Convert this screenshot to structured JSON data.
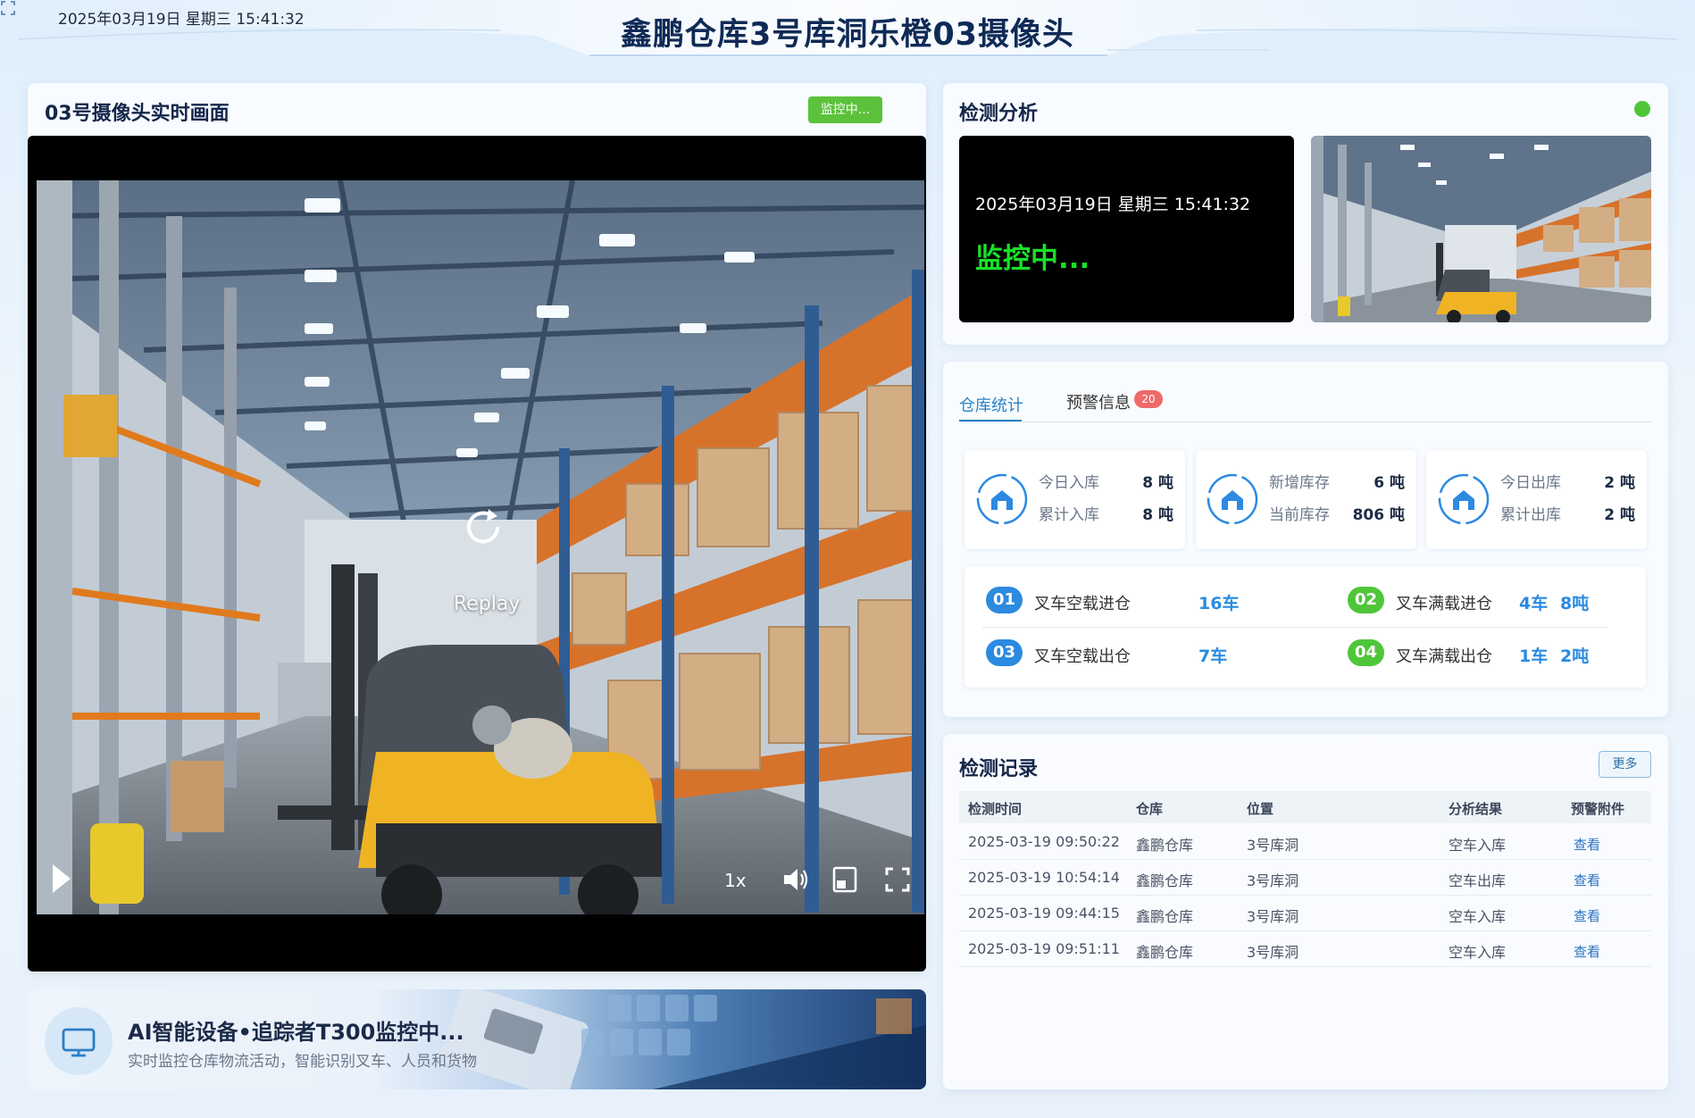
{
  "header": {
    "datetime": "2025年03月19日 星期三 15:41:32",
    "title": "鑫鹏仓库3号库洞乐橙03摄像头",
    "fullscreen_icon": "fullscreen-icon"
  },
  "video_panel": {
    "title": "03号摄像头实时画面",
    "status_badge": "监控中...",
    "replay_label": "Replay",
    "speed": "1x",
    "icons": [
      "play-icon",
      "replay-icon",
      "volume-icon",
      "picture-in-picture-icon",
      "fullscreen-icon"
    ]
  },
  "banner": {
    "title": "AI智能设备•追踪者T300监控中...",
    "subtitle": "实时监控仓库物流活动，智能识别叉车、人员和货物",
    "icon": "monitor-icon"
  },
  "detection": {
    "title": "检测分析",
    "datetime": "2025年03月19日 星期三 15:41:32",
    "status": "监控中...",
    "status_color": "#19e227"
  },
  "stats": {
    "tabs": [
      {
        "label": "仓库统计",
        "active": true
      },
      {
        "label": "预警信息",
        "active": false,
        "count": "20"
      }
    ],
    "cards": [
      {
        "icon": "warehouse-in-icon",
        "row1_label": "今日入库",
        "row1_value": "8 吨",
        "row2_label": "累计入库",
        "row2_value": "8 吨"
      },
      {
        "icon": "warehouse-icon",
        "row1_label": "新增库存",
        "row1_value": "6 吨",
        "row2_label": "当前库存",
        "row2_value": "806 吨"
      },
      {
        "icon": "warehouse-out-icon",
        "row1_label": "今日出库",
        "row1_value": "2 吨",
        "row2_label": "累计出库",
        "row2_value": "2 吨"
      }
    ],
    "forklift": [
      {
        "num": "01",
        "label": "叉车空载进仓",
        "value1": "16车",
        "value2": ""
      },
      {
        "num": "02",
        "label": "叉车满载进仓",
        "value1": "4车",
        "value2": "8吨"
      },
      {
        "num": "03",
        "label": "叉车空载出仓",
        "value1": "7车",
        "value2": ""
      },
      {
        "num": "04",
        "label": "叉车满载出仓",
        "value1": "1车",
        "value2": "2吨"
      }
    ]
  },
  "records": {
    "title": "检测记录",
    "more": "更多",
    "columns": [
      "检测时间",
      "仓库",
      "位置",
      "分析结果",
      "预警附件"
    ],
    "rows": [
      {
        "time": "2025-03-19 09:50:22",
        "warehouse": "鑫鹏仓库",
        "location": "3号库洞",
        "result": "空车入库",
        "attachment": "查看"
      },
      {
        "time": "2025-03-19 10:54:14",
        "warehouse": "鑫鹏仓库",
        "location": "3号库洞",
        "result": "空车出库",
        "attachment": "查看"
      },
      {
        "time": "2025-03-19 09:44:15",
        "warehouse": "鑫鹏仓库",
        "location": "3号库洞",
        "result": "空车入库",
        "attachment": "查看"
      },
      {
        "time": "2025-03-19 09:51:11",
        "warehouse": "鑫鹏仓库",
        "location": "3号库洞",
        "result": "空车入库",
        "attachment": "查看"
      }
    ]
  }
}
